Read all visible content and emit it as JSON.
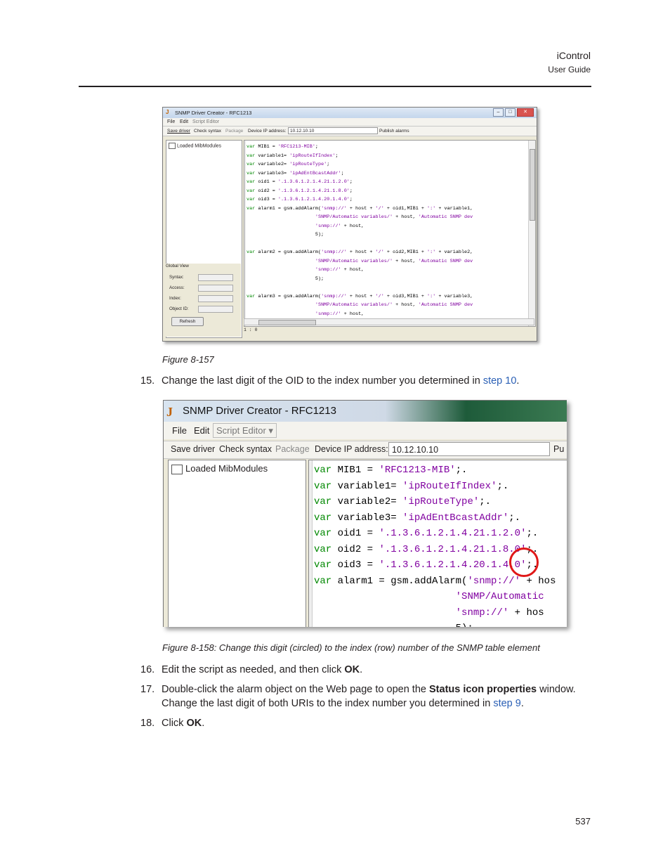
{
  "header": {
    "title": "iControl",
    "subtitle": "User Guide"
  },
  "figure1": {
    "window_title": "SNMP Driver Creator - RFC1213",
    "menu": {
      "file": "File",
      "edit": "Edit",
      "script_editor": "Script Editor"
    },
    "toolbar": {
      "save_driver": "Save driver",
      "check_syntax": "Check syntax",
      "package": "Package",
      "ip_label": "Device IP address:",
      "ip_value": "10.12.10.10",
      "publish": "Publish alarms"
    },
    "tree_root": "Loaded MibModules",
    "global_view": "Global View",
    "fields": {
      "syntax": "Syntax:",
      "access": "Access:",
      "index": "Index:",
      "object_id": "Object ID:"
    },
    "refresh": "Refresh",
    "status": "1 : 0",
    "caption": "Figure 8-157"
  },
  "step15": {
    "num": "15.",
    "text": "Change the last digit of the OID to the index number you determined in ",
    "link": "step 10",
    "end": "."
  },
  "figure2": {
    "window_title": "SNMP Driver Creator - RFC1213",
    "menu": {
      "file": "File",
      "edit": "Edit",
      "script_editor": "Script Editor"
    },
    "toolbar": {
      "save_driver": "Save driver",
      "check_syntax": "Check syntax",
      "package": "Package",
      "ip_label": "Device IP address:",
      "ip_value": "10.12.10.10",
      "publish_partial": "Pu"
    },
    "tree_root": "Loaded MibModules",
    "caption": "Figure 8-158:  Change this digit (circled) to the index (row) number of the SNMP table element"
  },
  "step16": {
    "num": "16.",
    "text_a": "Edit the script as needed, and then click ",
    "bold": "OK",
    "text_b": "."
  },
  "step17": {
    "num": "17.",
    "text_a": "Double-click the alarm object on the Web page to open the ",
    "bold": "Status icon properties",
    "text_b": " window. Change the last digit of both URIs to the index number you determined in ",
    "link": "step 9",
    "text_c": "."
  },
  "step18": {
    "num": "18.",
    "text_a": "Click ",
    "bold": "OK",
    "text_b": "."
  },
  "page_number": "537"
}
